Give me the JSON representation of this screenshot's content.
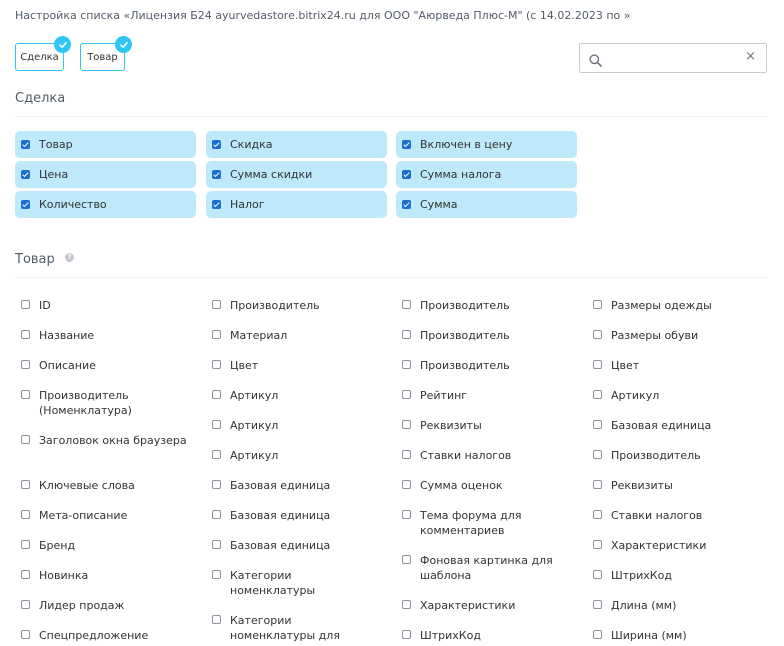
{
  "title": "Настройка списка «Лицензия Б24 ayurvedastore.bitrix24.ru для ООО \"Аюрведа Плюс-М\" (с 14.02.2023 по »",
  "tabs": [
    {
      "label": "Сделка",
      "checked": true
    },
    {
      "label": "Товар",
      "checked": true
    }
  ],
  "search": {
    "value": "",
    "placeholder": "",
    "clear_glyph": "×",
    "icon": "search-icon"
  },
  "deal_section": {
    "title": "Сделка",
    "items": [
      {
        "label": "Товар",
        "checked": true
      },
      {
        "label": "Скидка",
        "checked": true
      },
      {
        "label": "Включен в цену",
        "checked": true
      },
      {
        "label": "Цена",
        "checked": true
      },
      {
        "label": "Сумма скидки",
        "checked": true
      },
      {
        "label": "Сумма налога",
        "checked": true
      },
      {
        "label": "Количество",
        "checked": true
      },
      {
        "label": "Налог",
        "checked": true
      },
      {
        "label": "Сумма",
        "checked": true
      }
    ]
  },
  "product_section": {
    "title": "Товар",
    "help_glyph": "?",
    "columns": [
      [
        {
          "label": "ID",
          "checked": false
        },
        {
          "label": "Название",
          "checked": false
        },
        {
          "label": "Описание",
          "checked": false
        },
        {
          "label": "Производитель (Номенклатура)",
          "checked": false
        },
        {
          "label": "Заголовок окна браузера",
          "checked": false
        },
        {
          "label": "Ключевые слова",
          "checked": false
        },
        {
          "label": "Мета-описание",
          "checked": false
        },
        {
          "label": "Бренд",
          "checked": false
        },
        {
          "label": "Новинка",
          "checked": false
        },
        {
          "label": "Лидер продаж",
          "checked": false
        },
        {
          "label": "Спецпредложение",
          "checked": false
        }
      ],
      [
        {
          "label": "Производитель",
          "checked": false
        },
        {
          "label": "Материал",
          "checked": false
        },
        {
          "label": "Цвет",
          "checked": false
        },
        {
          "label": "Артикул",
          "checked": false
        },
        {
          "label": "Артикул",
          "checked": false
        },
        {
          "label": "Артикул",
          "checked": false
        },
        {
          "label": "Базовая единица",
          "checked": false
        },
        {
          "label": "Базовая единица",
          "checked": false
        },
        {
          "label": "Базовая единица",
          "checked": false
        },
        {
          "label": "Категории номенклатуры",
          "checked": false
        },
        {
          "label": "Категории номенклатуры для",
          "checked": false
        }
      ],
      [
        {
          "label": "Производитель",
          "checked": false
        },
        {
          "label": "Производитель",
          "checked": false
        },
        {
          "label": "Производитель",
          "checked": false
        },
        {
          "label": "Рейтинг",
          "checked": false
        },
        {
          "label": "Реквизиты",
          "checked": false
        },
        {
          "label": "Ставки налогов",
          "checked": false
        },
        {
          "label": "Сумма оценок",
          "checked": false
        },
        {
          "label": "Тема форума для комментариев",
          "checked": false
        },
        {
          "label": "Фоновая картинка для шаблона",
          "checked": false
        },
        {
          "label": "Характеристики",
          "checked": false
        },
        {
          "label": "ШтрихКод",
          "checked": false
        }
      ],
      [
        {
          "label": "Размеры одежды",
          "checked": false
        },
        {
          "label": "Размеры обуви",
          "checked": false
        },
        {
          "label": "Цвет",
          "checked": false
        },
        {
          "label": "Артикул",
          "checked": false
        },
        {
          "label": "Базовая единица",
          "checked": false
        },
        {
          "label": "Производитель",
          "checked": false
        },
        {
          "label": "Реквизиты",
          "checked": false
        },
        {
          "label": "Ставки налогов",
          "checked": false
        },
        {
          "label": "Характеристики",
          "checked": false
        },
        {
          "label": "ШтрихКод",
          "checked": false
        },
        {
          "label": "Длина (мм)",
          "checked": false
        },
        {
          "label": "Ширина (мм)",
          "checked": false
        }
      ]
    ]
  }
}
